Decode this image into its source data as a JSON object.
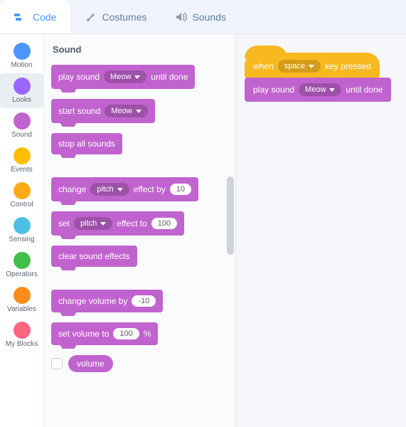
{
  "tabs": {
    "code": "Code",
    "costumes": "Costumes",
    "sounds": "Sounds"
  },
  "categories": [
    {
      "name": "Motion",
      "color": "#4c97ff"
    },
    {
      "name": "Looks",
      "color": "#9966ff"
    },
    {
      "name": "Sound",
      "color": "#c163cf"
    },
    {
      "name": "Events",
      "color": "#ffbf00"
    },
    {
      "name": "Control",
      "color": "#ffab19"
    },
    {
      "name": "Sensing",
      "color": "#4cbfe6"
    },
    {
      "name": "Operators",
      "color": "#40bf4a"
    },
    {
      "name": "Variables",
      "color": "#ff8c1a"
    },
    {
      "name": "My Blocks",
      "color": "#ff6680"
    }
  ],
  "palette": {
    "title": "Sound",
    "blocks": {
      "play_until": {
        "pre": "play sound",
        "dd": "Meow",
        "post": "until done"
      },
      "start": {
        "pre": "start sound",
        "dd": "Meow"
      },
      "stop_all": {
        "label": "stop all sounds"
      },
      "change_fx": {
        "pre": "change",
        "dd": "pitch",
        "mid": "effect by",
        "val": "10"
      },
      "set_fx": {
        "pre": "set",
        "dd": "pitch",
        "mid": "effect to",
        "val": "100"
      },
      "clear_fx": {
        "label": "clear sound effects"
      },
      "change_vol": {
        "pre": "change volume by",
        "val": "-10"
      },
      "set_vol": {
        "pre": "set volume to",
        "val": "100",
        "post": "%"
      },
      "reporter": {
        "label": "volume"
      }
    }
  },
  "script": {
    "hat": {
      "pre": "when",
      "dd": "space",
      "post": "key pressed"
    },
    "b1": {
      "pre": "play sound",
      "dd": "Meow",
      "post": "until done"
    }
  }
}
